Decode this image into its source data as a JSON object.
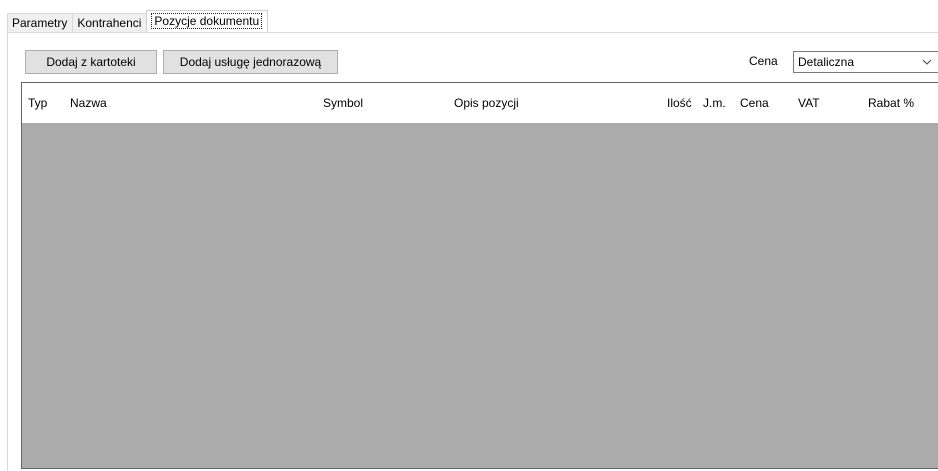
{
  "tabs": [
    {
      "label": "Parametry"
    },
    {
      "label": "Kontrahenci"
    },
    {
      "label": "Pozycje dokumentu"
    }
  ],
  "toolbar": {
    "add_from_catalog_label": "Dodaj z kartoteki",
    "add_one_time_service_label": "Dodaj usługę jednorazową",
    "price_label": "Cena",
    "price_select_value": "Detaliczna"
  },
  "grid": {
    "columns": [
      "Typ",
      "Nazwa",
      "Symbol",
      "Opis pozycji",
      "Ilość",
      "J.m.",
      "Cena",
      "VAT",
      "Rabat %"
    ],
    "rows": []
  },
  "colors": {
    "grid_background": "#ababab",
    "button_background": "#e1e1e1"
  },
  "icons": {
    "select_arrow": "chevron-down-icon"
  }
}
